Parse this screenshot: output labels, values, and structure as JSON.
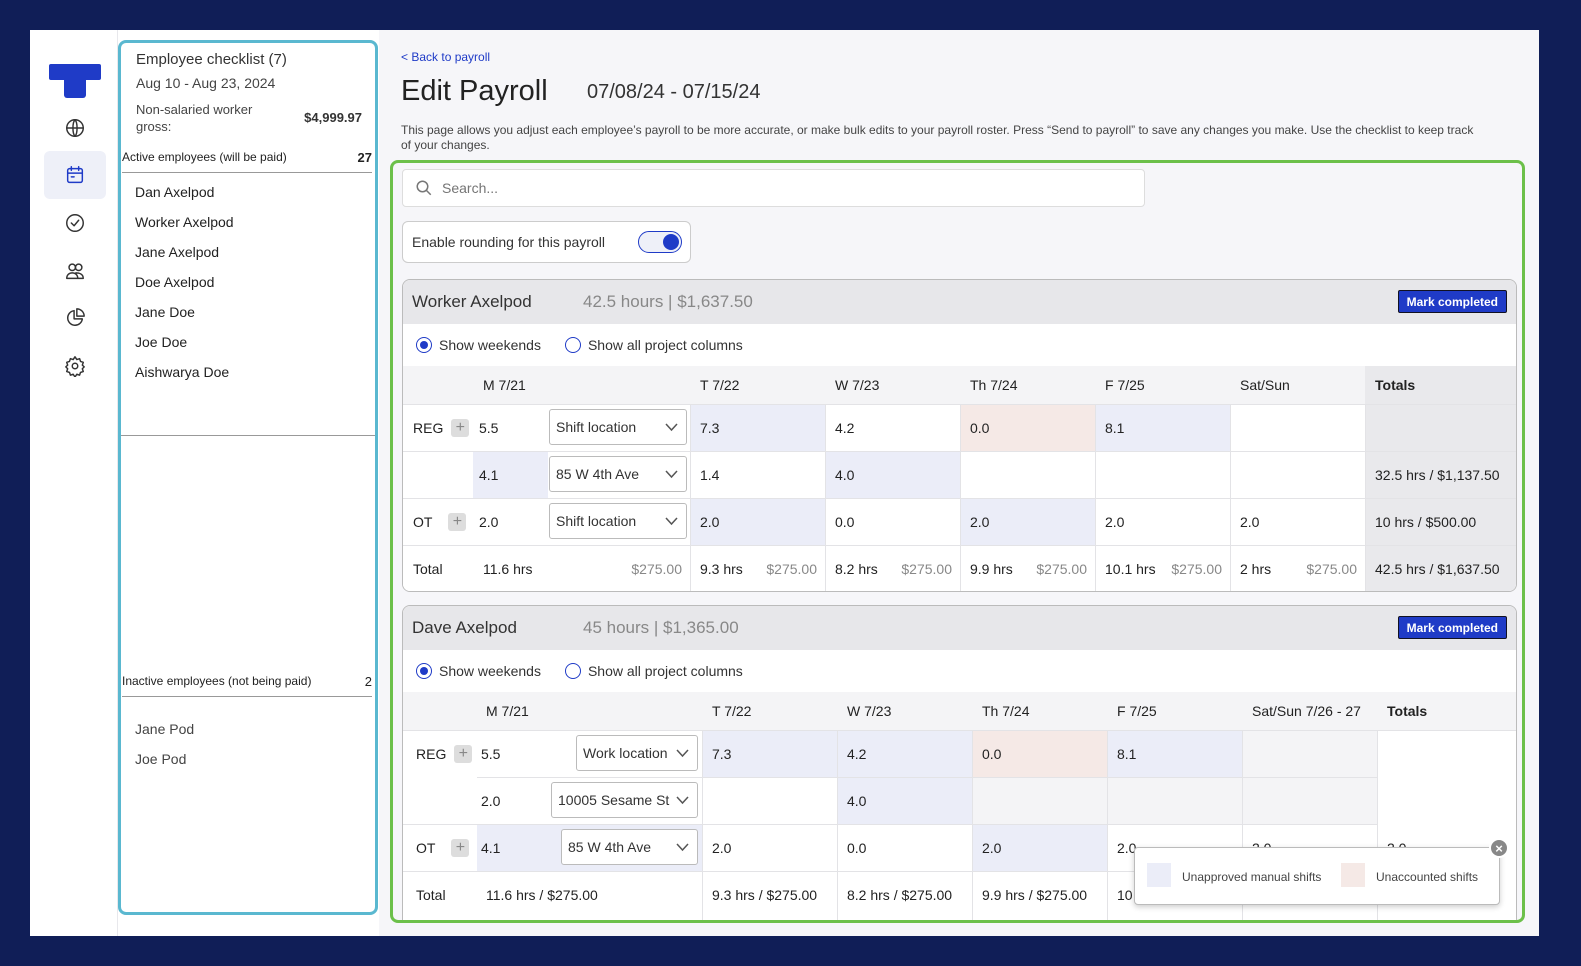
{
  "checklist": {
    "title": "Employee checklist (7)",
    "date_range": "Aug 10 - Aug 23, 2024",
    "gross_label": "Non-salaried worker gross:",
    "gross_value": "$4,999.97",
    "active_label": "Active employees (will be paid)",
    "active_count": "27",
    "active_employees": [
      "Dan Axelpod",
      "Worker Axelpod",
      "Jane Axelpod",
      "Doe Axelpod",
      "Jane Doe",
      "Joe Doe",
      "Aishwarya Doe"
    ],
    "inactive_label": "Inactive employees (not being paid)",
    "inactive_count": "2",
    "inactive_employees": [
      "Jane Pod",
      "Joe Pod"
    ]
  },
  "nav": {
    "icons": [
      "logo",
      "globe-icon",
      "calendar-icon",
      "check-circle-icon",
      "users-icon",
      "pie-chart-icon",
      "gear-icon"
    ]
  },
  "header": {
    "back_link": "< Back to payroll",
    "title": "Edit Payroll",
    "period": "07/08/24 - 07/15/24",
    "description": "This page allows you adjust each employee’s payroll to be more accurate, or make bulk edits to your payroll roster. Press “Send to payroll”  to save any changes you make. Use the checklist to keep track of your changes."
  },
  "search": {
    "placeholder": "Search..."
  },
  "rounding": {
    "label": "Enable rounding for this payroll",
    "enabled": true
  },
  "radios": {
    "weekends": "Show weekends",
    "projects": "Show all project columns"
  },
  "mark_completed": "Mark completed",
  "employees": [
    {
      "name": "Worker Axelpod",
      "summary": "42.5 hours | $1,637.50",
      "days": [
        "M  7/21",
        "T  7/22",
        "W  7/23",
        "Th  7/24",
        "F  7/25",
        "Sat/Sun"
      ],
      "totals_header": "Totals",
      "reg_label": "REG",
      "ot_label": "OT",
      "total_label": "Total",
      "reg1": {
        "mon": "5.5",
        "loc": "Shift location",
        "tue": "7.3",
        "wed": "4.2",
        "thu": "0.0",
        "fri": "8.1",
        "sat": ""
      },
      "reg2": {
        "mon": "4.1",
        "loc": "85 W 4th Ave",
        "tue": "1.4",
        "wed": "4.0",
        "thu": "",
        "fri": "",
        "sat": "",
        "total": "32.5 hrs  /  $1,137.50"
      },
      "ot": {
        "mon": "2.0",
        "loc": "Shift location",
        "tue": "2.0",
        "wed": "0.0",
        "thu": "2.0",
        "fri": "2.0",
        "sat": "2.0",
        "total": "10 hrs  /  $500.00"
      },
      "totals": {
        "mon": [
          "11.6 hrs",
          "$275.00"
        ],
        "tue": [
          "9.3 hrs",
          "$275.00"
        ],
        "wed": [
          "8.2 hrs",
          "$275.00"
        ],
        "thu": [
          "9.9 hrs",
          "$275.00"
        ],
        "fri": [
          "10.1 hrs",
          "$275.00"
        ],
        "sat": [
          "2 hrs",
          "$275.00"
        ],
        "grand": "42.5 hrs  /  $1,637.50"
      }
    },
    {
      "name": "Dave Axelpod",
      "summary": "45 hours | $1,365.00",
      "days": [
        "M  7/21",
        "T  7/22",
        "W  7/23",
        "Th  7/24",
        "F  7/25",
        "Sat/Sun  7/26 - 27"
      ],
      "totals_header": "Totals",
      "reg_label": "REG",
      "ot_label": "OT",
      "total_label": "Total",
      "reg1": {
        "mon": "5.5",
        "loc": "Work location",
        "tue": "7.3",
        "wed": "4.2",
        "thu": "0.0",
        "fri": "8.1"
      },
      "reg2": {
        "mon": "2.0",
        "loc": "10005 Sesame St",
        "wed": "4.0"
      },
      "ot": {
        "mon": "4.1",
        "loc": "85 W 4th Ave",
        "tue": "2.0",
        "wed": "0.0",
        "thu": "2.0",
        "fri": "2.0",
        "sat": "2.0",
        "total": "2.0"
      },
      "totals": {
        "mon": "11.6 hrs / $275.00",
        "tue": "9.3 hrs / $275.00",
        "wed": "8.2 hrs / $275.00",
        "thu": "9.9 hrs / $275.00",
        "fri": "10"
      }
    }
  ],
  "legend": {
    "manual": "Unapproved manual shifts",
    "unaccounted": "Unaccounted shifts",
    "colors": {
      "manual": "#ebedf8",
      "unaccounted": "#f5e9e6"
    }
  },
  "colors": {
    "accent": "#1f3bc7",
    "frame_border": "#6cc04a",
    "checklist_border": "#5ab8d0",
    "background": "#101e57"
  }
}
